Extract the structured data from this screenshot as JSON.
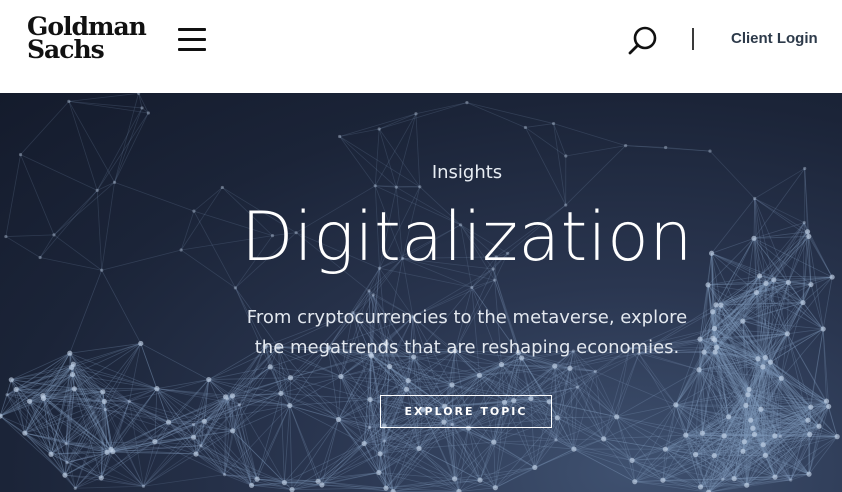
{
  "header": {
    "logo_line1": "Goldman",
    "logo_line2": "Sachs",
    "client_login": "Client Login",
    "icons": {
      "menu": "hamburger-menu-icon",
      "search": "search-icon"
    }
  },
  "hero": {
    "eyebrow": "Insights",
    "title": "Digitalization",
    "description_line1": "From cryptocurrencies to the metaverse, explore",
    "description_line2": "the megatrends that are reshaping economies.",
    "cta_label": "EXPLORE TOPIC"
  },
  "colors": {
    "header_bg": "#ffffff",
    "hero_bg": "#1b2438",
    "network_lines": "#7f97b8",
    "network_nodes": "#c3d2e6"
  }
}
